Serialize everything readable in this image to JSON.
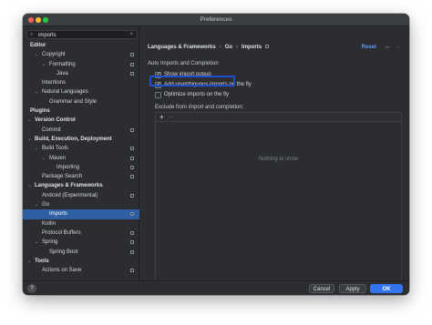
{
  "window": {
    "title": "Preferences"
  },
  "search": {
    "value": "imports"
  },
  "tree": [
    {
      "label": "Editor",
      "indent": 0,
      "arrow": "",
      "bold": true,
      "proj": false,
      "selected": false
    },
    {
      "label": "Copyright",
      "indent": 1,
      "arrow": "v",
      "bold": false,
      "proj": true,
      "selected": false
    },
    {
      "label": "Formatting",
      "indent": 2,
      "arrow": "v",
      "bold": false,
      "proj": true,
      "selected": false
    },
    {
      "label": "Java",
      "indent": 3,
      "arrow": "",
      "bold": false,
      "proj": true,
      "selected": false
    },
    {
      "label": "Intentions",
      "indent": 1,
      "arrow": "",
      "bold": false,
      "proj": false,
      "selected": false
    },
    {
      "label": "Natural Languages",
      "indent": 1,
      "arrow": "v",
      "bold": false,
      "proj": false,
      "selected": false
    },
    {
      "label": "Grammar and Style",
      "indent": 2,
      "arrow": "",
      "bold": false,
      "proj": false,
      "selected": false
    },
    {
      "label": "Plugins",
      "indent": 0,
      "arrow": "",
      "bold": true,
      "proj": false,
      "selected": false
    },
    {
      "label": "Version Control",
      "indent": 0,
      "arrow": "v",
      "bold": true,
      "proj": false,
      "selected": false
    },
    {
      "label": "Commit",
      "indent": 1,
      "arrow": "",
      "bold": false,
      "proj": true,
      "selected": false
    },
    {
      "label": "Build, Execution, Deployment",
      "indent": 0,
      "arrow": "v",
      "bold": true,
      "proj": false,
      "selected": false
    },
    {
      "label": "Build Tools",
      "indent": 1,
      "arrow": "v",
      "bold": false,
      "proj": true,
      "selected": false
    },
    {
      "label": "Maven",
      "indent": 2,
      "arrow": "v",
      "bold": false,
      "proj": true,
      "selected": false
    },
    {
      "label": "Importing",
      "indent": 3,
      "arrow": "",
      "bold": false,
      "proj": true,
      "selected": false
    },
    {
      "label": "Package Search",
      "indent": 1,
      "arrow": "",
      "bold": false,
      "proj": true,
      "selected": false
    },
    {
      "label": "Languages & Frameworks",
      "indent": 0,
      "arrow": "v",
      "bold": true,
      "proj": false,
      "selected": false
    },
    {
      "label": "Android (Experimental)",
      "indent": 1,
      "arrow": "",
      "bold": false,
      "proj": true,
      "selected": false
    },
    {
      "label": "Go",
      "indent": 1,
      "arrow": "v",
      "bold": false,
      "proj": false,
      "selected": false
    },
    {
      "label": "Imports",
      "indent": 2,
      "arrow": "",
      "bold": false,
      "proj": true,
      "selected": true
    },
    {
      "label": "Kotlin",
      "indent": 1,
      "arrow": "",
      "bold": false,
      "proj": false,
      "selected": false
    },
    {
      "label": "Protocol Buffers",
      "indent": 1,
      "arrow": "",
      "bold": false,
      "proj": true,
      "selected": false
    },
    {
      "label": "Spring",
      "indent": 1,
      "arrow": "v",
      "bold": false,
      "proj": true,
      "selected": false
    },
    {
      "label": "Spring Boot",
      "indent": 2,
      "arrow": "",
      "bold": false,
      "proj": true,
      "selected": false
    },
    {
      "label": "Tools",
      "indent": 0,
      "arrow": "v",
      "bold": true,
      "proj": false,
      "selected": false
    },
    {
      "label": "Actions on Save",
      "indent": 1,
      "arrow": "",
      "bold": false,
      "proj": true,
      "selected": false
    }
  ],
  "breadcrumb": {
    "part1": "Languages & Frameworks",
    "part2": "Go",
    "part3": "Imports"
  },
  "toolbar": {
    "reset_label": "Reset"
  },
  "panel": {
    "section_title": "Auto Imports and Completion",
    "options": [
      {
        "label": "Show import popup",
        "checked": true
      },
      {
        "label": "Add unambiguous imports on the fly",
        "checked": true
      },
      {
        "label": "Optimize imports on the fly",
        "checked": false
      }
    ],
    "exclude_label": "Exclude from import and completion:",
    "empty_text": "Nothing to show"
  },
  "footer": {
    "help_label": "?",
    "cancel_label": "Cancel",
    "apply_label": "Apply",
    "ok_label": "OK"
  },
  "colors": {
    "accent": "#3574f0",
    "selection": "#2e5fa3",
    "highlight_border": "#1e4fd0"
  }
}
